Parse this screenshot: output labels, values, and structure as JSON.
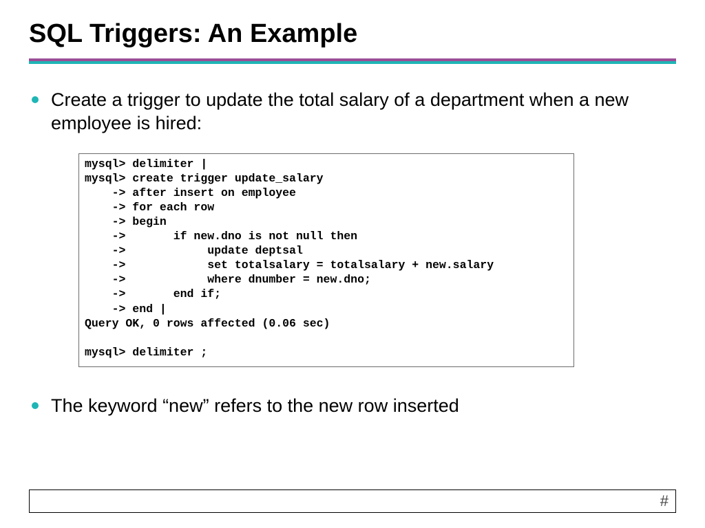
{
  "title": "SQL Triggers: An Example",
  "bullets": {
    "item1": "Create a trigger to update the total salary of a department when a new employee is hired:",
    "item2": "The keyword “new” refers to the new row inserted"
  },
  "code": "mysql> delimiter |\nmysql> create trigger update_salary\n    -> after insert on employee\n    -> for each row\n    -> begin\n    ->       if new.dno is not null then\n    ->            update deptsal\n    ->            set totalsalary = totalsalary + new.salary\n    ->            where dnumber = new.dno;\n    ->       end if;\n    -> end |\nQuery OK, 0 rows affected (0.06 sec)\n\nmysql> delimiter ;",
  "footer": {
    "page": "#"
  }
}
